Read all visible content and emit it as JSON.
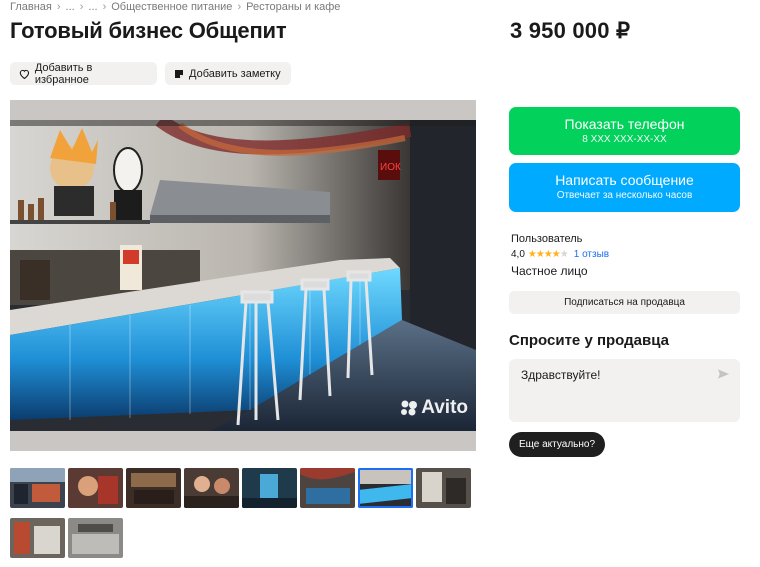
{
  "breadcrumbs": [
    "Главная",
    "...",
    "...",
    "Общественное питание",
    "Рестораны и кафе"
  ],
  "listing": {
    "title": "Готовый бизнес Общепит",
    "price": "3 950 000 ₽"
  },
  "actions": {
    "favorite_label": "Добавить в избранное",
    "note_label": "Добавить заметку"
  },
  "photo": {
    "watermark": "Avito",
    "thumbnail_count": 10,
    "active_thumbnail": 7
  },
  "contact": {
    "phone_label": "Показать телефон",
    "phone_masked": "8 XXX XXX-XX-XX",
    "message_label": "Написать сообщение",
    "message_sub": "Отвечает за несколько часов"
  },
  "seller": {
    "name": "Пользователь",
    "rating": "4,0",
    "stars_filled": 4,
    "stars_total": 5,
    "reviews": "1 отзыв",
    "type": "Частное лицо",
    "subscribe_label": "Подписаться на продавца"
  },
  "ask": {
    "title": "Спросите у продавца",
    "message": "Здравствуйте!",
    "quick_reply": "Еще актуально?"
  },
  "colors": {
    "green": "#02d15c",
    "blue": "#00aaff",
    "link": "#1c6ef2",
    "star": "#ffb021"
  }
}
